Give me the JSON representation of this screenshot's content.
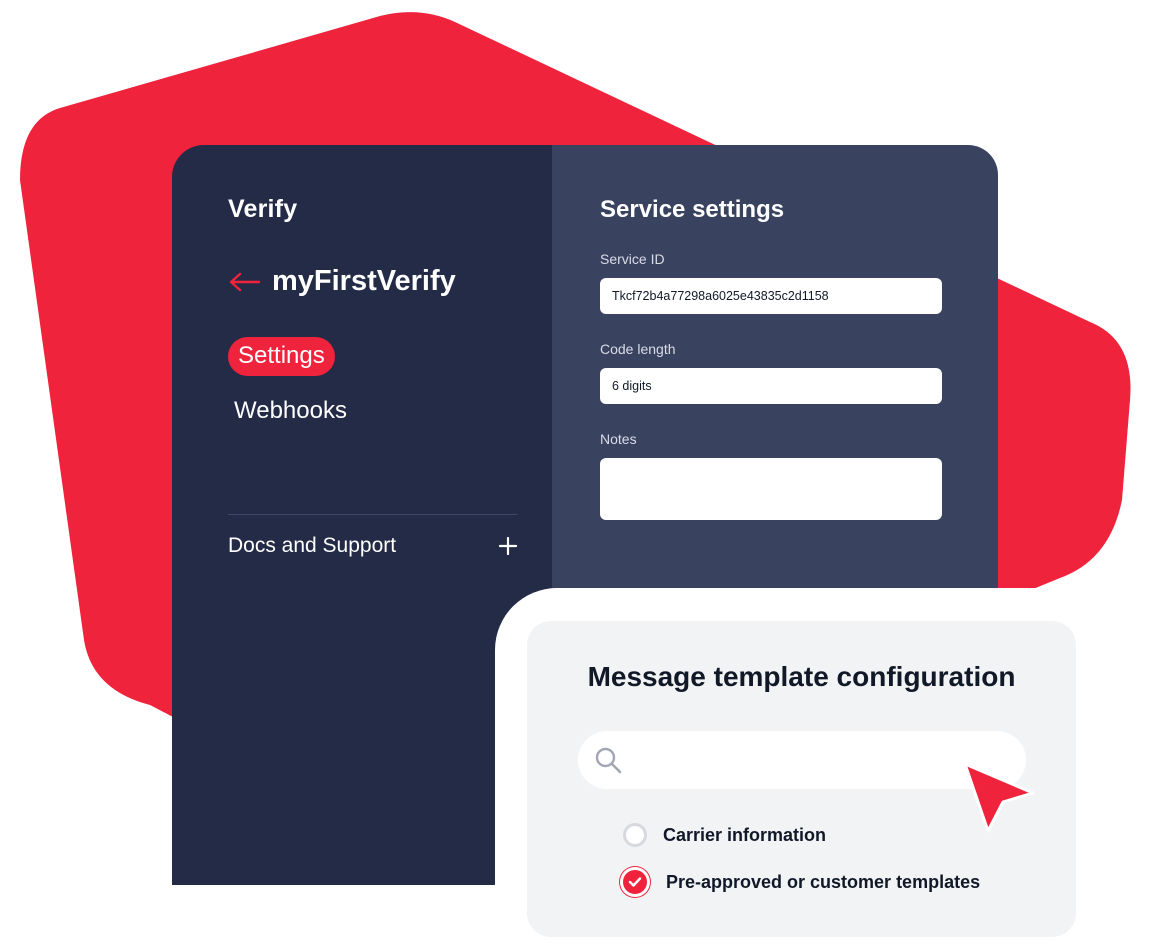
{
  "colors": {
    "accent": "#ef233c",
    "sidebar_bg": "#232b47",
    "panel_bg": "#394360",
    "card_bg": "#f2f3f5"
  },
  "sidebar": {
    "title": "Verify",
    "back_icon": "arrow-left-icon",
    "service_name": "myFirstVerify",
    "nav": [
      {
        "label": "Settings",
        "active": true
      },
      {
        "label": "Webhooks",
        "active": false
      }
    ],
    "docs_label": "Docs and Support",
    "docs_icon": "plus-icon"
  },
  "settings": {
    "title": "Service settings",
    "fields": [
      {
        "label": "Service ID",
        "value": "Tkcf72b4a77298a6025e43835c2d1158"
      },
      {
        "label": "Code length",
        "value": "6 digits"
      },
      {
        "label": "Notes",
        "value": ""
      }
    ]
  },
  "template_card": {
    "title": "Message template configuration",
    "search_icon": "search-icon",
    "search_value": "",
    "options": [
      {
        "label": "Carrier information",
        "checked": false
      },
      {
        "label": "Pre-approved or customer templates",
        "checked": true
      }
    ]
  },
  "cursor_icon": "pointer-cursor-icon"
}
